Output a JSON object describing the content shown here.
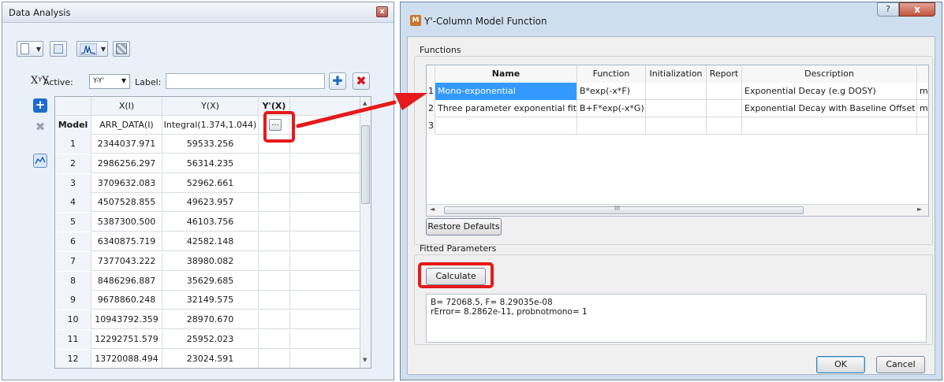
{
  "left_panel": {
    "title": "Data Analysis",
    "close_glyph": "x",
    "xy_symbol": "XᵞY",
    "active_label": "Active:",
    "active_value": "Y-Y'",
    "label_caption": "Label:",
    "label_value": "",
    "table": {
      "headers": [
        "",
        "X(I)",
        "Y(X)",
        "Y'(X)"
      ],
      "model_row": [
        "Model",
        "ARR_DATA(I)",
        "Integral(1.374,1.044)",
        "..."
      ],
      "rows": [
        [
          "1",
          "2344037.971",
          "59533.256"
        ],
        [
          "2",
          "2986256.297",
          "56314.235"
        ],
        [
          "3",
          "3709632.083",
          "52962.661"
        ],
        [
          "4",
          "4507528.855",
          "49623.957"
        ],
        [
          "5",
          "5387300.500",
          "46103.756"
        ],
        [
          "6",
          "6340875.719",
          "42582.148"
        ],
        [
          "7",
          "7377043.222",
          "38980.082"
        ],
        [
          "8",
          "8486296.887",
          "35629.685"
        ],
        [
          "9",
          "9678860.248",
          "32149.575"
        ],
        [
          "10",
          "10943792.359",
          "28970.670"
        ],
        [
          "11",
          "12292751.579",
          "25952.023"
        ],
        [
          "12",
          "13720088.494",
          "23024.591"
        ]
      ]
    }
  },
  "dialog": {
    "title": "Y'-Column Model Function",
    "help_glyph": "?",
    "close_glyph": "x",
    "functions_group_label": "Functions",
    "fn_table": {
      "headers": [
        "Name",
        "Function",
        "Initialization",
        "Report",
        "Description"
      ],
      "rows": [
        {
          "index": "1",
          "name": "Mono-exponential",
          "function": "B*exp(-x*F)",
          "init": "",
          "report": "",
          "description": "Exponential Decay (e.g DOSY)",
          "extra": "m"
        },
        {
          "index": "2",
          "name": "Three parameter exponential fit",
          "function": "B+F*exp(-x*G)",
          "init": "",
          "report": "",
          "description": "Exponential Decay with Baseline Offset",
          "extra": "m"
        },
        {
          "index": "3",
          "name": "",
          "function": "",
          "init": "",
          "report": "",
          "description": "",
          "extra": ""
        }
      ],
      "scroll_mark": "III"
    },
    "restore_defaults": "Restore Defaults",
    "fitted_group_label": "Fitted Parameters",
    "calculate": "Calculate",
    "fit_output": "B= 72068.5, F= 8.29035e-08\nrError= 8.2862e-11, probnotmono= 1",
    "ok": "OK",
    "cancel": "Cancel"
  },
  "colors": {
    "highlight": "#e51a1a",
    "selection": "#3399ff",
    "dialog_frame": "#cfdff0"
  }
}
